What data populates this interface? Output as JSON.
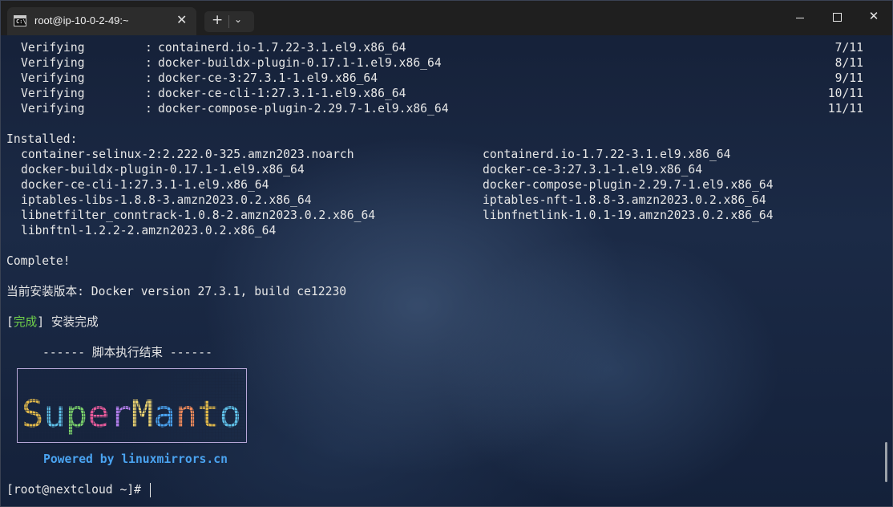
{
  "window": {
    "tab_title": "root@ip-10-0-2-49:~",
    "tab_icon_text": "C:\\",
    "tab_close": "✕",
    "new_tab": "+",
    "dropdown": "⌄",
    "minimize": "",
    "maximize": "",
    "close": "✕"
  },
  "verifying": [
    {
      "label": "Verifying",
      "sep": ":",
      "pkg": "containerd.io-1.7.22-3.1.el9.x86_64",
      "count": "7/11"
    },
    {
      "label": "Verifying",
      "sep": ":",
      "pkg": "docker-buildx-plugin-0.17.1-1.el9.x86_64",
      "count": "8/11"
    },
    {
      "label": "Verifying",
      "sep": ":",
      "pkg": "docker-ce-3:27.3.1-1.el9.x86_64",
      "count": "9/11"
    },
    {
      "label": "Verifying",
      "sep": ":",
      "pkg": "docker-ce-cli-1:27.3.1-1.el9.x86_64",
      "count": "10/11"
    },
    {
      "label": "Verifying",
      "sep": ":",
      "pkg": "docker-compose-plugin-2.29.7-1.el9.x86_64",
      "count": "11/11"
    }
  ],
  "installed_heading": "Installed:",
  "installed": [
    [
      "container-selinux-2:2.222.0-325.amzn2023.noarch",
      "containerd.io-1.7.22-3.1.el9.x86_64"
    ],
    [
      "docker-buildx-plugin-0.17.1-1.el9.x86_64",
      "docker-ce-3:27.3.1-1.el9.x86_64"
    ],
    [
      "docker-ce-cli-1:27.3.1-1.el9.x86_64",
      "docker-compose-plugin-2.29.7-1.el9.x86_64"
    ],
    [
      "iptables-libs-1.8.8-3.amzn2023.0.2.x86_64",
      "iptables-nft-1.8.8-3.amzn2023.0.2.x86_64"
    ],
    [
      "libnetfilter_conntrack-1.0.8-2.amzn2023.0.2.x86_64",
      "libnfnetlink-1.0.1-19.amzn2023.0.2.x86_64"
    ],
    [
      "libnftnl-1.2.2-2.amzn2023.0.2.x86_64",
      ""
    ]
  ],
  "complete": "Complete!",
  "version_line": "当前安装版本: Docker version 27.3.1, build ce12230",
  "done": {
    "open": "[",
    "tag": "完成",
    "close": "]",
    "text": " 安装完成"
  },
  "script_end": "------ 脚本执行结束 ------",
  "banner": {
    "text": "SuperManto",
    "colors": [
      "#e0b84a",
      "#5fc0e8",
      "#7ad06a",
      "#e65a9a",
      "#b07de8",
      "#e8d070",
      "#4aa3f0",
      "#f08a5a"
    ]
  },
  "powered_by": "Powered by linuxmirrors.cn",
  "prompt": "[root@nextcloud ~]# "
}
